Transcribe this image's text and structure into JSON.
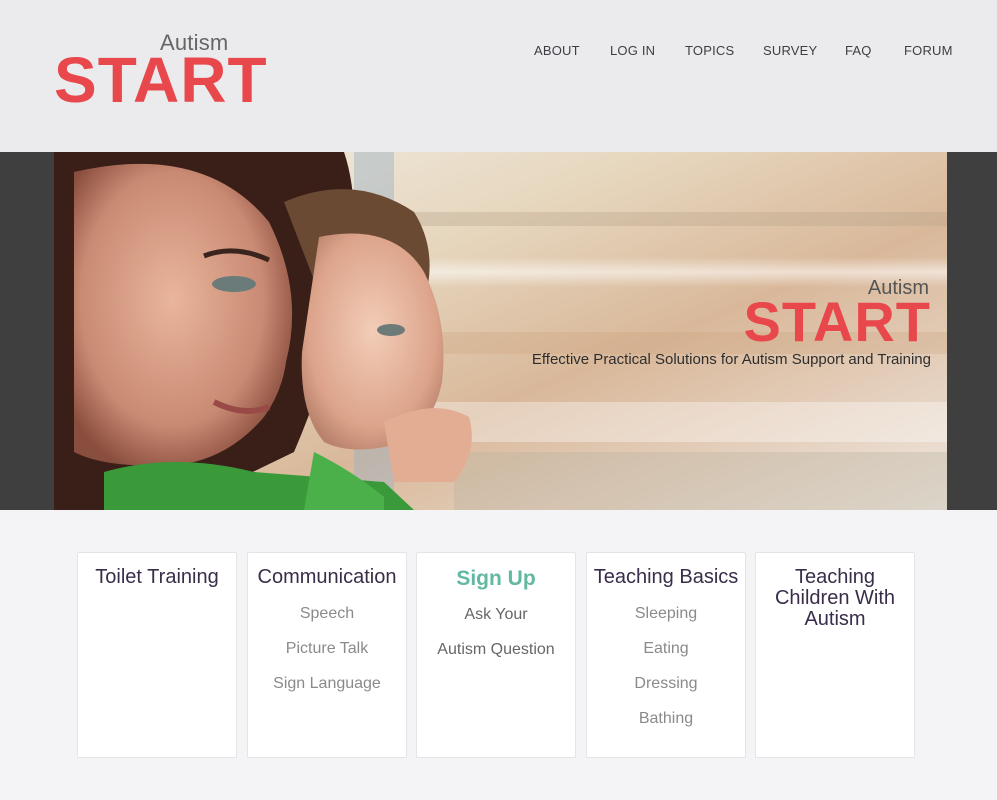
{
  "brand": {
    "small": "Autism",
    "big": "START",
    "accent_color": "#e8484b"
  },
  "nav": [
    {
      "label": "ABOUT"
    },
    {
      "label": "LOG IN"
    },
    {
      "label": "TOPICS"
    },
    {
      "label": "SURVEY"
    },
    {
      "label": "FAQ"
    },
    {
      "label": "FORUM"
    }
  ],
  "hero": {
    "logo_small": "Autism",
    "logo_big": "START",
    "tagline": "Effective Practical Solutions for Autism Support and Training",
    "image": "mother-and-child-at-train-window"
  },
  "cards": [
    {
      "title": "Toilet Training",
      "items": []
    },
    {
      "title": "Communication",
      "items": [
        "Speech",
        "Picture Talk",
        "Sign Language"
      ]
    },
    {
      "title": "Sign Up",
      "items": [
        "Ask Your",
        "Autism Question"
      ],
      "accent_color": "#63b8a2"
    },
    {
      "title": "Teaching Basics",
      "items": [
        "Sleeping",
        "Eating",
        "Dressing",
        "Bathing"
      ]
    },
    {
      "title": "Teaching Children With Autism",
      "items": []
    }
  ]
}
